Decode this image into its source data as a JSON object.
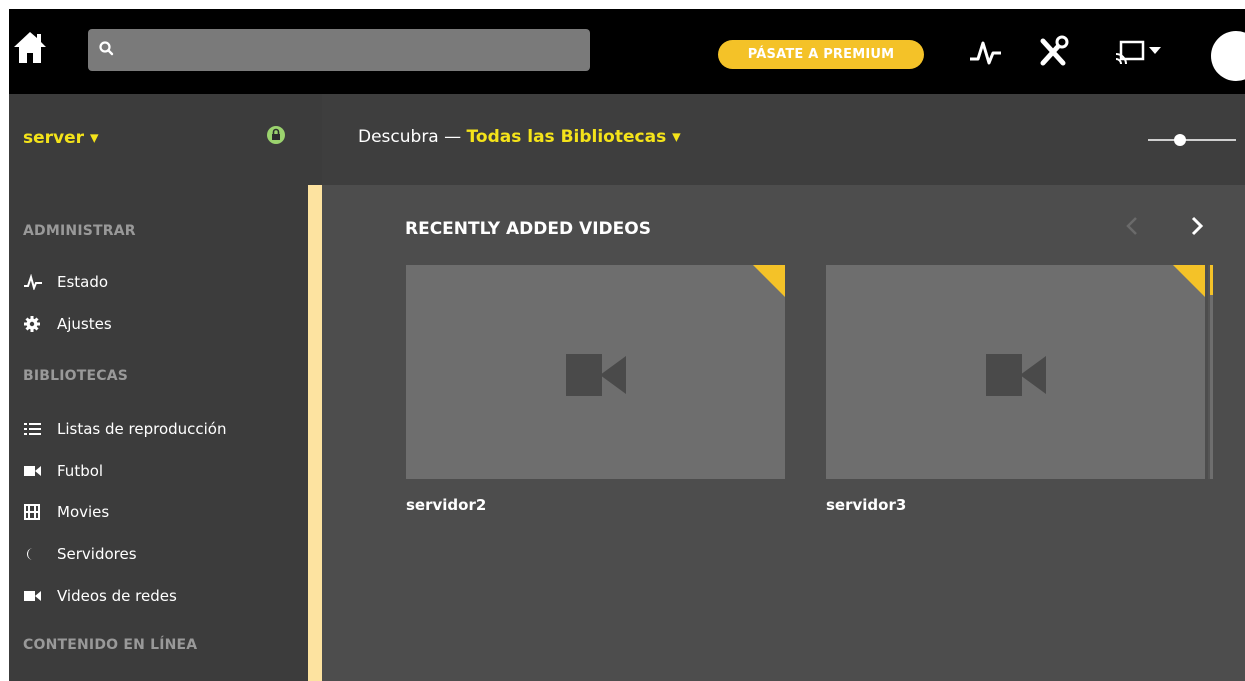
{
  "header": {
    "search_placeholder": "",
    "premium_label": "PÁSATE A PREMIUM",
    "icons": [
      "home-icon",
      "search-icon",
      "activity-icon",
      "tools-icon",
      "cast-icon",
      "avatar"
    ]
  },
  "server": {
    "name": "server ▾"
  },
  "breadcrumb": {
    "prefix": "Descubra",
    "separator": " — ",
    "library": "Todas las Bibliotecas ▾"
  },
  "sidebar": {
    "sections": [
      {
        "title": "ADMINISTRAR"
      },
      {
        "title": "BIBLIOTECAS"
      },
      {
        "title": "CONTENIDO EN LÍNEA"
      }
    ],
    "admin_items": [
      {
        "label": "Estado",
        "icon": "activity-icon"
      },
      {
        "label": "Ajustes",
        "icon": "gear-icon"
      }
    ],
    "library_items": [
      {
        "label": "Listas de reproducción",
        "icon": "playlist-icon"
      },
      {
        "label": "Futbol",
        "icon": "video-camera-icon"
      },
      {
        "label": "Movies",
        "icon": "film-icon"
      },
      {
        "label": "Servidores",
        "icon": "moon-icon"
      },
      {
        "label": "Videos de redes",
        "icon": "video-camera-icon"
      }
    ]
  },
  "main": {
    "section_title": "RECENTLY ADDED VIDEOS",
    "cards": [
      {
        "title": "servidor2"
      },
      {
        "title": "servidor3"
      }
    ]
  },
  "colors": {
    "accent_yellow": "#f4e31a",
    "premium": "#f4c228",
    "sidebar_accent": "#fde3a0",
    "lock_green": "#9bd36e"
  }
}
